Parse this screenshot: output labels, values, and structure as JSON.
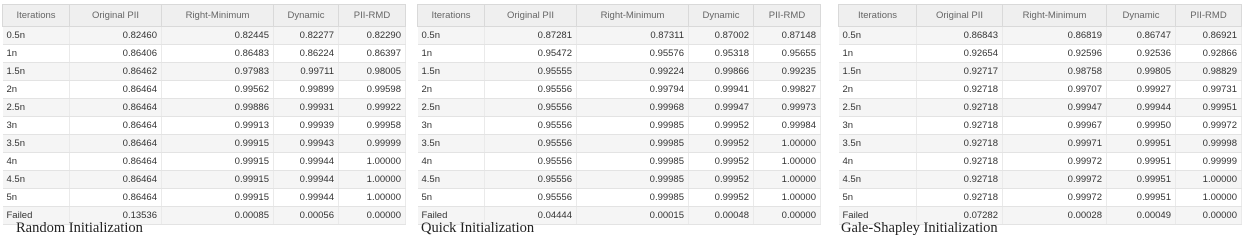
{
  "columns": [
    "Iterations",
    "Original PII",
    "Right-Minimum",
    "Dynamic",
    "PII-RMD"
  ],
  "panels": [
    {
      "caption": "Random Initialization",
      "rows": [
        [
          "0.5n",
          "0.82460",
          "0.82445",
          "0.82277",
          "0.82290"
        ],
        [
          "1n",
          "0.86406",
          "0.86483",
          "0.86224",
          "0.86397"
        ],
        [
          "1.5n",
          "0.86462",
          "0.97983",
          "0.99711",
          "0.98005"
        ],
        [
          "2n",
          "0.86464",
          "0.99562",
          "0.99899",
          "0.99598"
        ],
        [
          "2.5n",
          "0.86464",
          "0.99886",
          "0.99931",
          "0.99922"
        ],
        [
          "3n",
          "0.86464",
          "0.99913",
          "0.99939",
          "0.99958"
        ],
        [
          "3.5n",
          "0.86464",
          "0.99915",
          "0.99943",
          "0.99999"
        ],
        [
          "4n",
          "0.86464",
          "0.99915",
          "0.99944",
          "1.00000"
        ],
        [
          "4.5n",
          "0.86464",
          "0.99915",
          "0.99944",
          "1.00000"
        ],
        [
          "5n",
          "0.86464",
          "0.99915",
          "0.99944",
          "1.00000"
        ],
        [
          "Failed",
          "0.13536",
          "0.00085",
          "0.00056",
          "0.00000"
        ]
      ]
    },
    {
      "caption": "Quick Initialization",
      "rows": [
        [
          "0.5n",
          "0.87281",
          "0.87311",
          "0.87002",
          "0.87148"
        ],
        [
          "1n",
          "0.95472",
          "0.95576",
          "0.95318",
          "0.95655"
        ],
        [
          "1.5n",
          "0.95555",
          "0.99224",
          "0.99866",
          "0.99235"
        ],
        [
          "2n",
          "0.95556",
          "0.99794",
          "0.99941",
          "0.99827"
        ],
        [
          "2.5n",
          "0.95556",
          "0.99968",
          "0.99947",
          "0.99973"
        ],
        [
          "3n",
          "0.95556",
          "0.99985",
          "0.99952",
          "0.99984"
        ],
        [
          "3.5n",
          "0.95556",
          "0.99985",
          "0.99952",
          "1.00000"
        ],
        [
          "4n",
          "0.95556",
          "0.99985",
          "0.99952",
          "1.00000"
        ],
        [
          "4.5n",
          "0.95556",
          "0.99985",
          "0.99952",
          "1.00000"
        ],
        [
          "5n",
          "0.95556",
          "0.99985",
          "0.99952",
          "1.00000"
        ],
        [
          "Failed",
          "0.04444",
          "0.00015",
          "0.00048",
          "0.00000"
        ]
      ]
    },
    {
      "caption": "Gale-Shapley Initialization",
      "rows": [
        [
          "0.5n",
          "0.86843",
          "0.86819",
          "0.86747",
          "0.86921"
        ],
        [
          "1n",
          "0.92654",
          "0.92596",
          "0.92536",
          "0.92866"
        ],
        [
          "1.5n",
          "0.92717",
          "0.98758",
          "0.99805",
          "0.98829"
        ],
        [
          "2n",
          "0.92718",
          "0.99707",
          "0.99927",
          "0.99731"
        ],
        [
          "2.5n",
          "0.92718",
          "0.99947",
          "0.99944",
          "0.99951"
        ],
        [
          "3n",
          "0.92718",
          "0.99967",
          "0.99950",
          "0.99972"
        ],
        [
          "3.5n",
          "0.92718",
          "0.99971",
          "0.99951",
          "0.99998"
        ],
        [
          "4n",
          "0.92718",
          "0.99972",
          "0.99951",
          "0.99999"
        ],
        [
          "4.5n",
          "0.92718",
          "0.99972",
          "0.99951",
          "1.00000"
        ],
        [
          "5n",
          "0.92718",
          "0.99972",
          "0.99951",
          "1.00000"
        ],
        [
          "Failed",
          "0.07282",
          "0.00028",
          "0.00049",
          "0.00000"
        ]
      ]
    }
  ]
}
